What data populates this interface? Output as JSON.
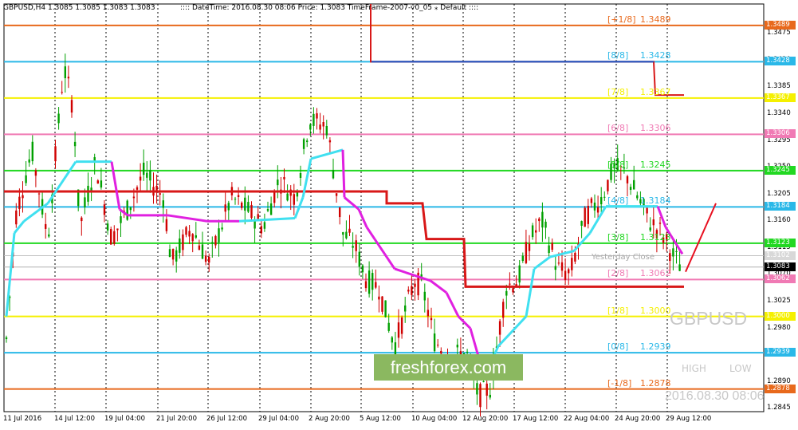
{
  "header": {
    "symbol_info": "GBPUSD,H4  1.3085 1.3085 1.3083 1.3083",
    "indicator_info": ":::: DateTime: 2016.08.30 08:06    Price: 1.3083    TimeFrame-2007-v0_05    ⁎    Default   ::::"
  },
  "levels": [
    {
      "label": "[+1/8]",
      "value": "1.3489",
      "tag": "1.3489",
      "price": 1.3489,
      "color": "#e8691c",
      "tag_text": "#ffffff"
    },
    {
      "label": "[8/8]",
      "value": "1.3428",
      "tag": "1.3428",
      "price": 1.3428,
      "color": "#2ab8e8",
      "tag_text": "#ffffff"
    },
    {
      "label": "[7/8]",
      "value": "1.3367",
      "tag": "1.3367",
      "price": 1.3367,
      "color": "#f5f000",
      "tag_text": "#ffffff"
    },
    {
      "label": "[6/8]",
      "value": "1.3306",
      "tag": "1.3306",
      "price": 1.3306,
      "color": "#f07ab4",
      "tag_text": "#ffffff"
    },
    {
      "label": "[5/8]",
      "value": "1.3245",
      "tag": "1.3245",
      "price": 1.3245,
      "color": "#22d822",
      "tag_text": "#ffffff"
    },
    {
      "label": "[4/8]",
      "value": "1.3184",
      "tag": "1.3184",
      "price": 1.3184,
      "color": "#2ab8e8",
      "tag_text": "#ffffff"
    },
    {
      "label": "[3/8]",
      "value": "1.3123",
      "tag": "1.3123",
      "price": 1.3123,
      "color": "#22d822",
      "tag_text": "#ffffff"
    },
    {
      "label": "[2/8]",
      "value": "1.3062",
      "tag": "1.3062",
      "price": 1.3062,
      "color": "#f07ab4",
      "tag_text": "#ffffff"
    },
    {
      "label": "[1/8]",
      "value": "1.3000",
      "tag": "1.3000",
      "price": 1.3,
      "color": "#f5f000",
      "tag_text": "#ffffff"
    },
    {
      "label": "[0/8]",
      "value": "1.2939",
      "tag": "1.2939",
      "price": 1.2939,
      "color": "#2ab8e8",
      "tag_text": "#ffffff"
    },
    {
      "label": "[-1/8]",
      "value": "1.2878",
      "tag": "1.2878",
      "price": 1.2878,
      "color": "#e8691c",
      "tag_text": "#ffffff"
    }
  ],
  "price_axis": [
    "1.3475",
    "1.3430",
    "1.3385",
    "1.3340",
    "1.3295",
    "1.3250",
    "1.3205",
    "1.3160",
    "1.3115",
    "1.3070",
    "1.3025",
    "1.2980",
    "1.2935",
    "1.2890",
    "1.2845"
  ],
  "current_price": {
    "tag": "1.3083",
    "price": 1.3083
  },
  "yesterday_close": {
    "text": "Yesterday Close",
    "tag": "1.3102",
    "price": 1.3102
  },
  "time_axis": [
    "11 Jul 2016",
    "14 Jul 12:00",
    "19 Jul 04:00",
    "21 Jul 20:00",
    "26 Jul 12:00",
    "29 Jul 04:00",
    "2 Aug 20:00",
    "5 Aug 12:00",
    "10 Aug 04:00",
    "12 Aug 20:00",
    "17 Aug 12:00",
    "22 Aug 04:00",
    "24 Aug 20:00",
    "29 Aug 12:00"
  ],
  "overlay": {
    "symbol": "GBPUSD",
    "high_label": "HIGH",
    "low_label": "LOW",
    "datetime": "2016.08.30 08:06",
    "logo": "freshforex.com"
  },
  "colors": {
    "bull_candle": "#00a000",
    "bear_candle": "#d00000",
    "mtf_line": "#d81818",
    "trail_cyan": "#40e0f0",
    "trail_magenta": "#e020e0",
    "grid": "#000000"
  },
  "chart_data": {
    "type": "candlestick",
    "symbol": "GBPUSD",
    "timeframe": "H4",
    "ylim": [
      1.284,
      1.3525
    ],
    "current_price": 1.3083,
    "murrey_levels": [
      1.3489,
      1.3428,
      1.3367,
      1.3306,
      1.3245,
      1.3184,
      1.3123,
      1.3062,
      1.3,
      1.2939,
      1.2878
    ],
    "key_closes": [
      {
        "date": "11 Jul 2016",
        "price": 1.2945
      },
      {
        "date": "14 Jul 12:00",
        "price": 1.334
      },
      {
        "date": "19 Jul 04:00",
        "price": 1.321
      },
      {
        "date": "21 Jul 20:00",
        "price": 1.312
      },
      {
        "date": "26 Jul 12:00",
        "price": 1.313
      },
      {
        "date": "29 Jul 04:00",
        "price": 1.321
      },
      {
        "date": "2 Aug 20:00",
        "price": 1.332
      },
      {
        "date": "5 Aug 12:00",
        "price": 1.308
      },
      {
        "date": "10 Aug 04:00",
        "price": 1.301
      },
      {
        "date": "12 Aug 20:00",
        "price": 1.287
      },
      {
        "date": "17 Aug 12:00",
        "price": 1.305
      },
      {
        "date": "22 Aug 04:00",
        "price": 1.314
      },
      {
        "date": "24 Aug 20:00",
        "price": 1.323
      },
      {
        "date": "29 Aug 12:00",
        "price": 1.3083
      }
    ]
  }
}
